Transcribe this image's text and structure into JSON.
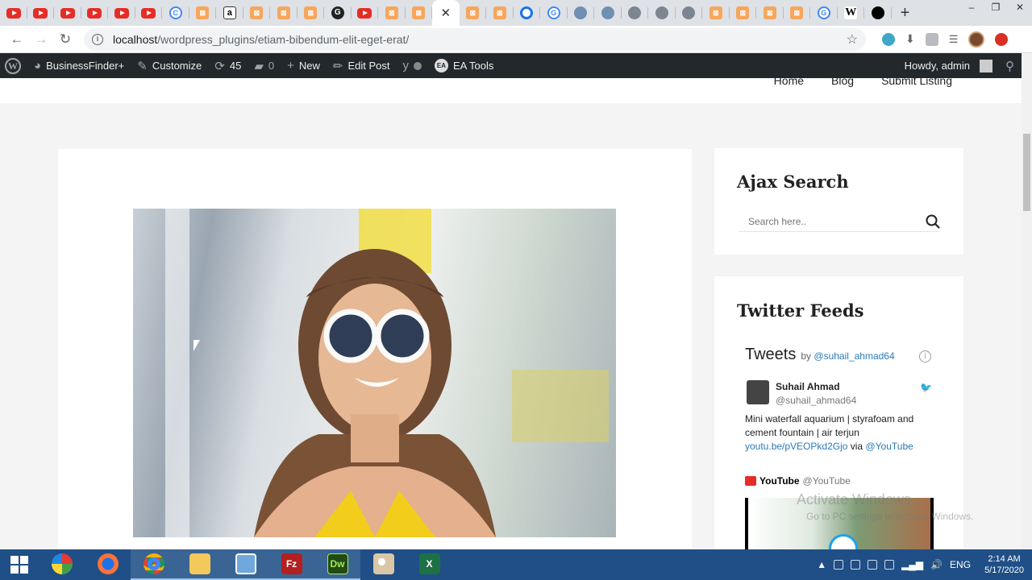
{
  "browser": {
    "tabs": [
      {
        "icon": "youtube-icon"
      },
      {
        "icon": "youtube-icon"
      },
      {
        "icon": "youtube-icon"
      },
      {
        "icon": "youtube-icon"
      },
      {
        "icon": "youtube-icon"
      },
      {
        "icon": "youtube-icon"
      },
      {
        "icon": "c-icon"
      },
      {
        "icon": "xampp-icon"
      },
      {
        "icon": "amazon-icon"
      },
      {
        "icon": "xampp-icon"
      },
      {
        "icon": "xampp-icon"
      },
      {
        "icon": "xampp-icon"
      },
      {
        "icon": "g-dark-icon"
      },
      {
        "icon": "youtube-icon"
      },
      {
        "icon": "xampp-icon"
      },
      {
        "icon": "xampp-icon"
      },
      {
        "icon": "close-icon",
        "active": true
      },
      {
        "icon": "xampp-icon"
      },
      {
        "icon": "xampp-icon"
      },
      {
        "icon": "ring-icon"
      },
      {
        "icon": "google-icon"
      },
      {
        "icon": "wordpress-icon"
      },
      {
        "icon": "wordpress-icon"
      },
      {
        "icon": "globe-icon"
      },
      {
        "icon": "globe-icon"
      },
      {
        "icon": "globe-icon"
      },
      {
        "icon": "xampp-icon"
      },
      {
        "icon": "xampp-icon"
      },
      {
        "icon": "xampp-icon"
      },
      {
        "icon": "xampp-icon"
      },
      {
        "icon": "google-icon"
      },
      {
        "icon": "wikipedia-icon"
      },
      {
        "icon": "github-icon"
      }
    ],
    "tab_glyphs": {
      "amazon": "a",
      "c": "C",
      "g": "G",
      "google": "G",
      "wiki": "W"
    },
    "new_tab": "+",
    "url": "localhost/wordpress_plugins/etiam-bibendum-elit-eget-erat/",
    "url_host": "localhost",
    "url_path": "/wordpress_plugins/etiam-bibendum-elit-eget-erat/"
  },
  "adminbar": {
    "logo": "W",
    "site_name": "BusinessFinder+",
    "customize": "Customize",
    "updates_count": "45",
    "comments_count": "0",
    "new": "New",
    "edit_post": "Edit Post",
    "ea_badge": "EA",
    "ea_tools": "EA Tools",
    "howdy": "Howdy, admin"
  },
  "site": {
    "nav": [
      "Home",
      "Blog",
      "Submit Listing"
    ],
    "ajax_search": {
      "title": "Ajax Search",
      "placeholder": "Search here.."
    },
    "twitter": {
      "title": "Twitter Feeds",
      "tweets_label": "Tweets",
      "by": "by",
      "handle": "@suhail_ahmad64",
      "info": "i",
      "author_name": "Suhail Ahmad",
      "author_handle": "@suhail_ahmad64",
      "text": "Mini waterfall aquarium | styrafoam and cement fountain | air terjun",
      "link": "youtu.be/pVEOPkd2Gjo",
      "via": "via",
      "via_handle": "@YouTube",
      "retweet_name": "YouTube",
      "retweet_handle": "@YouTube"
    }
  },
  "watermark": {
    "line1": "Activate Windows",
    "line2": "Go to PC settings to activate Windows."
  },
  "taskbar": {
    "apps": [
      "windows-media-icon",
      "firefox-icon",
      "chrome-icon",
      "file-explorer-icon",
      "picture-viewer-icon",
      "filezilla-icon",
      "dreamweaver-icon",
      "paint-icon",
      "excel-icon"
    ],
    "lang": "ENG",
    "time": "2:14 AM",
    "date": "5/17/2020"
  },
  "colors": {
    "admin_bar": "#23282d",
    "taskbar": "#1f4f86",
    "link": "#2b7bb9",
    "youtube_red": "#e52d27"
  }
}
